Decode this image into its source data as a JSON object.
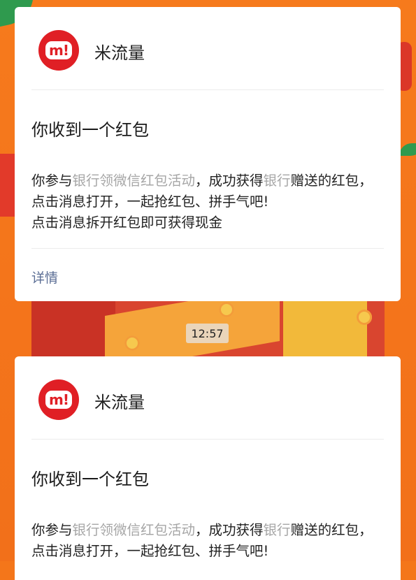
{
  "time": "12:57",
  "messages": [
    {
      "app_name": "米流量",
      "logo_text": "m!",
      "title": "你收到一个红包",
      "body": {
        "p1": "你参与",
        "h1": "银行领微信红包活动",
        "p2": "，成功获得",
        "h2": "银行",
        "p3": "赠送的红包，点击消息打开，一起抢红包、拼手气吧!",
        "line2": "点击消息拆开红包即可获得现金"
      },
      "link": "详情"
    },
    {
      "app_name": "米流量",
      "logo_text": "m!",
      "title": "你收到一个红包",
      "body": {
        "p1": "你参与",
        "h1": "银行领微信红包活动",
        "p2": "，成功获得",
        "h2": "银行",
        "p3": "赠送的红包，点击消息打开，一起抢红包、拼手气吧!"
      }
    }
  ]
}
